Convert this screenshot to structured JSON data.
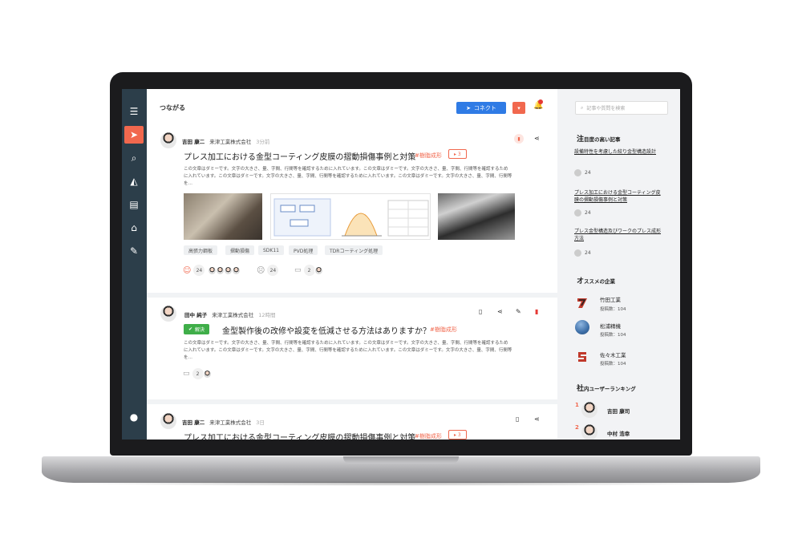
{
  "app": {
    "title": "つながる",
    "connect_label": "コネクト",
    "notification_count": "1"
  },
  "sidebar": {
    "icons": [
      "menu-icon",
      "send-icon",
      "search-icon",
      "chart-icon",
      "chat-icon",
      "building-icon",
      "wrench-icon",
      "account-icon"
    ]
  },
  "posts": [
    {
      "author": "吉田 康二",
      "company": "来津工業株式会社",
      "time": "3分前",
      "title": "プレス加工における金型コーティング皮膜の摺動損傷事例と対策",
      "category": "#樹脂成形",
      "tag_count": "3",
      "body": "この文章はダミーです。文字の大きさ、量、字間、行間等を確認するために入れています。この文章はダミーです。文字の大きさ、量、字間、行間等を確認するために入れています。この文章はダミーです。文字の大きさ、量、字間、行間等を確認するために入れています。この文章はダミーです。文字の大きさ、量、字間、行間等を…",
      "chips": [
        "高張力鋼板",
        "摺動損傷",
        "SDK11",
        "PVD処理",
        "TDRコーティング処理"
      ],
      "reactions": {
        "like": "24",
        "question": "24",
        "comment": "2"
      }
    },
    {
      "author": "田中 純子",
      "company": "来津工業株式会社",
      "time": "12時間",
      "solved_label": "解決",
      "title": "金型製作後の改修や設変を低減させる方法はありますか？",
      "category": "#樹脂成形",
      "body": "この文章はダミーです。文字の大きさ、量、字間、行間等を確認するために入れています。この文章はダミーです。文字の大きさ、量、字間、行間等を確認するために入れています。この文章はダミーです。文字の大きさ、量、字間、行間等を確認するために入れています。この文章はダミーです。文字の大きさ、量、字間、行間等を…",
      "reactions": {
        "comment": "2"
      }
    },
    {
      "author": "吉田 康二",
      "company": "来津工業株式会社",
      "time": "3日",
      "title": "プレス加工における金型コーティング皮膜の摺動損傷事例と対策",
      "category": "#樹脂成形",
      "tag_count": "3"
    }
  ],
  "right": {
    "search_placeholder": "記事や質問を検索",
    "hot_title_big": "注",
    "hot_title": "目度の高い記事",
    "articles": [
      {
        "title": "設備特性を考慮した絞り金型構造設計",
        "count": "24"
      },
      {
        "title": "プレス加工における金型コーティング皮膜の摺動損傷事例と対策",
        "count": "24"
      },
      {
        "title": "プレス金型構造及びワークのプレス成形方法",
        "count": "24"
      }
    ],
    "companies_title_big": "オ",
    "companies_title": "ススメの企業",
    "companies": [
      {
        "name": "竹田工業",
        "posts": "投稿数：104"
      },
      {
        "name": "松浦精機",
        "posts": "投稿数：104"
      },
      {
        "name": "佐々木工業",
        "posts": "投稿数：104"
      }
    ],
    "ranking_title_big": "社",
    "ranking_title": "内ユーザーランキング",
    "ranking": [
      {
        "rank": "1",
        "name": "吉田 康司"
      },
      {
        "rank": "2",
        "name": "中村 浩幸"
      }
    ]
  },
  "colors": {
    "accent": "#f1684e",
    "primary": "#2f7be5",
    "sidebar": "#2c3e4a",
    "solved": "#3fae49"
  }
}
